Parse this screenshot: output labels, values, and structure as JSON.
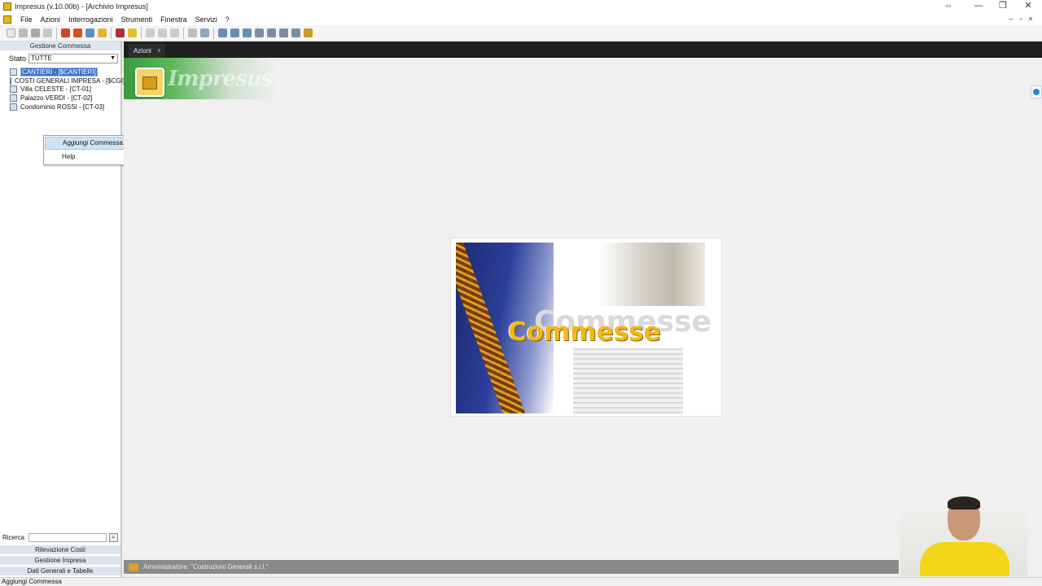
{
  "window": {
    "title": "Impresus (v.10.00b) - [Archivio Impresus]",
    "controls": {
      "move": "⇔",
      "minimize": "—",
      "restore": "❐",
      "close": "✕"
    },
    "mdi_controls": {
      "minimize": "–",
      "restore": "▫",
      "close": "×"
    }
  },
  "menubar": [
    "File",
    "Azioni",
    "Interrogazioni",
    "Strumenti",
    "Finestra",
    "Servizi",
    "?"
  ],
  "left_panel": {
    "header": "Gestione Commessa",
    "stato_label": "Stato",
    "stato_value": "TUTTE",
    "tree": [
      {
        "label": "CANTIERI - [$CANTIERI]",
        "selected": true
      },
      {
        "label": "COSTI GENERALI IMPRESA - [$CGI]",
        "selected": false
      },
      {
        "label": "Villa CELESTE - [CT-01]",
        "selected": false
      },
      {
        "label": "Palazzo VERDI - [CT-02]",
        "selected": false
      },
      {
        "label": "Condominio ROSSI - [CT-03]",
        "selected": false
      }
    ],
    "ricerca_label": "Ricerca",
    "nav_buttons": [
      "Rilevazione Costi",
      "Gestione Impresa",
      "Dati Generali e Tabelle"
    ]
  },
  "context_menu": {
    "items": [
      "Aggiungi Commessa...",
      "Help"
    ],
    "highlighted": 0
  },
  "workarea": {
    "tab_label": "Azioni",
    "tab_close": "x",
    "banner_text": "Impresus",
    "splash_title": "Commesse",
    "splash_shadow_text": "Commesse"
  },
  "status": {
    "user": "Amministratore: \"Costruzioni Generali s.r.l.\"",
    "bottom": "Aggiungi Commessa"
  },
  "colors": {
    "selection": "#3b73c5",
    "tab_bg": "#1f1f1f",
    "banner_green": "#3b9a3f",
    "splash_gold": "#f0b81a"
  }
}
